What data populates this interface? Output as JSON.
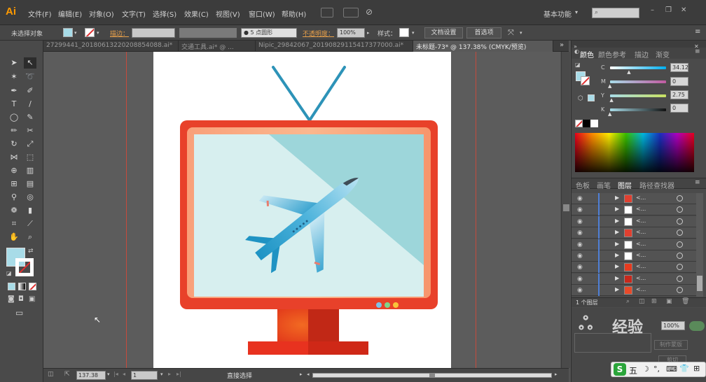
{
  "app": {
    "logo": "Ai"
  },
  "menubar": {
    "items": [
      "文件(F)",
      "编辑(E)",
      "对象(O)",
      "文字(T)",
      "选择(S)",
      "效果(C)",
      "视图(V)",
      "窗口(W)",
      "帮助(H)"
    ],
    "workspace": "基本功能",
    "workspace_arrow": "▾"
  },
  "controlbar": {
    "selection_label": "未选择对象",
    "stroke_label": "描边：",
    "brush_value": "5 点圆形",
    "opacity_label": "不透明度：",
    "opacity_value": "100%",
    "style_label": "样式：",
    "doc_setup_button": "文档设置",
    "prefs_button": "首选项"
  },
  "tabs": [
    {
      "label": "27299441_20180613220208854088.ai*",
      "active": false
    },
    {
      "label": "交通工具.ai* @ ...",
      "active": false
    },
    {
      "label": "Nipic_29842067_20190829115417377000.ai*",
      "active": false
    },
    {
      "label": "未标题-73* @ 137.38% (CMYK/预览)",
      "active": true
    }
  ],
  "tab_overflow": "»",
  "statusbar": {
    "zoom": "137.38",
    "page": "1",
    "tool_label": "直接选择"
  },
  "color_panel": {
    "tabs": [
      "颜色",
      "颜色参考",
      "描边",
      "渐变"
    ],
    "channels": [
      {
        "name": "C",
        "value": "34.12",
        "fraction": 0.34
      },
      {
        "name": "M",
        "value": "0",
        "fraction": 0
      },
      {
        "name": "Y",
        "value": "2.75",
        "fraction": 0.03
      },
      {
        "name": "K",
        "value": "0",
        "fraction": 0
      }
    ],
    "fill_color": "#a8dce8"
  },
  "layers_panel": {
    "tabs": [
      "色板",
      "画笔",
      "图层",
      "路径查找器"
    ],
    "row_label": "<...",
    "rows": [
      {
        "thumb": "#e04030"
      },
      {
        "thumb": "#ffffff"
      },
      {
        "thumb": "#ffffff"
      },
      {
        "thumb": "#e04030"
      },
      {
        "thumb": "#ffffff"
      },
      {
        "thumb": "#ffffff"
      },
      {
        "thumb": "#e63b1f"
      },
      {
        "thumb": "#c8281c"
      },
      {
        "thumb": "#e84a2a"
      }
    ],
    "layer_count": "1 个图层",
    "percent": "100%",
    "bottom_button": "制作蒙版",
    "clip_label": "剪切"
  },
  "watermark": "经验",
  "ime": {
    "items": [
      "S",
      "五",
      "☽",
      "°,",
      "⌨",
      "👕",
      "⊞"
    ]
  },
  "colors": {
    "tv_frame": "#e8412a",
    "screen": "#a6dcdf",
    "plane": "#2fa0c8"
  }
}
